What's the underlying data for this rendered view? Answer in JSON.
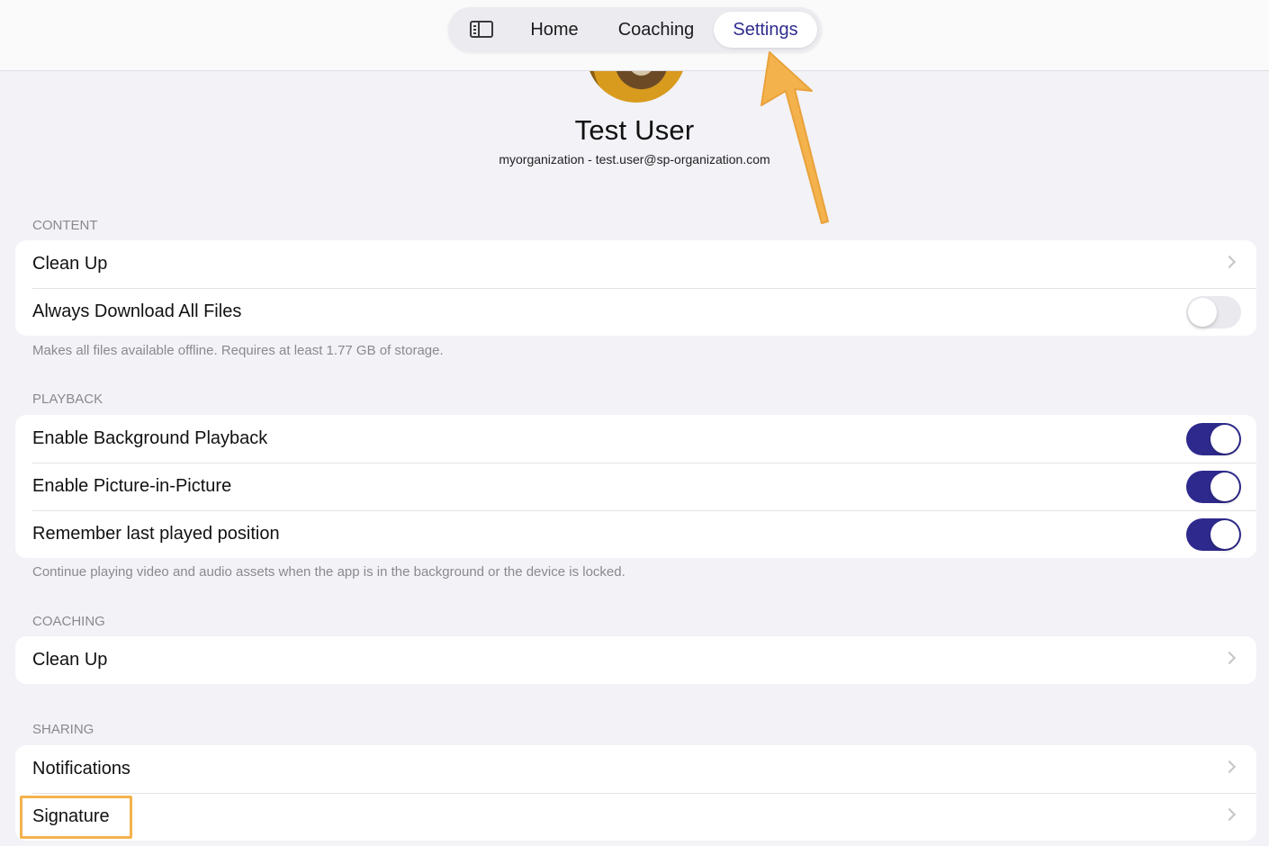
{
  "nav": {
    "sidebar_icon": "sidebar-toggle-icon",
    "tabs": [
      {
        "label": "Home",
        "selected": false
      },
      {
        "label": "Coaching",
        "selected": false
      },
      {
        "label": "Settings",
        "selected": true
      }
    ]
  },
  "profile": {
    "name": "Test User",
    "subtitle": "myorganization - test.user@sp-organization.com"
  },
  "sections": {
    "content": {
      "header": "CONTENT",
      "rows": [
        {
          "label": "Clean Up",
          "accessory": "chevron-right-icon"
        },
        {
          "label": "Always Download All Files",
          "toggle": false
        }
      ],
      "footer": "Makes all files available offline. Requires at least 1.77 GB of storage."
    },
    "playback": {
      "header": "PLAYBACK",
      "rows": [
        {
          "label": "Enable Background Playback",
          "toggle": true
        },
        {
          "label": "Enable Picture-in-Picture",
          "toggle": true
        },
        {
          "label": "Remember last played position",
          "toggle": true
        }
      ],
      "footer": "Continue playing video and audio assets when the app is in the background or the device is locked."
    },
    "coaching": {
      "header": "COACHING",
      "rows": [
        {
          "label": "Clean Up",
          "accessory": "chevron-right-icon"
        }
      ]
    },
    "sharing": {
      "header": "SHARING",
      "rows": [
        {
          "label": "Notifications",
          "accessory": "chevron-right-icon"
        },
        {
          "label": "Signature",
          "accessory": "chevron-right-icon"
        }
      ]
    }
  },
  "colors": {
    "accent": "#2e2a8d",
    "annotation": "#f4b24d",
    "background": "#f2f2f7"
  }
}
